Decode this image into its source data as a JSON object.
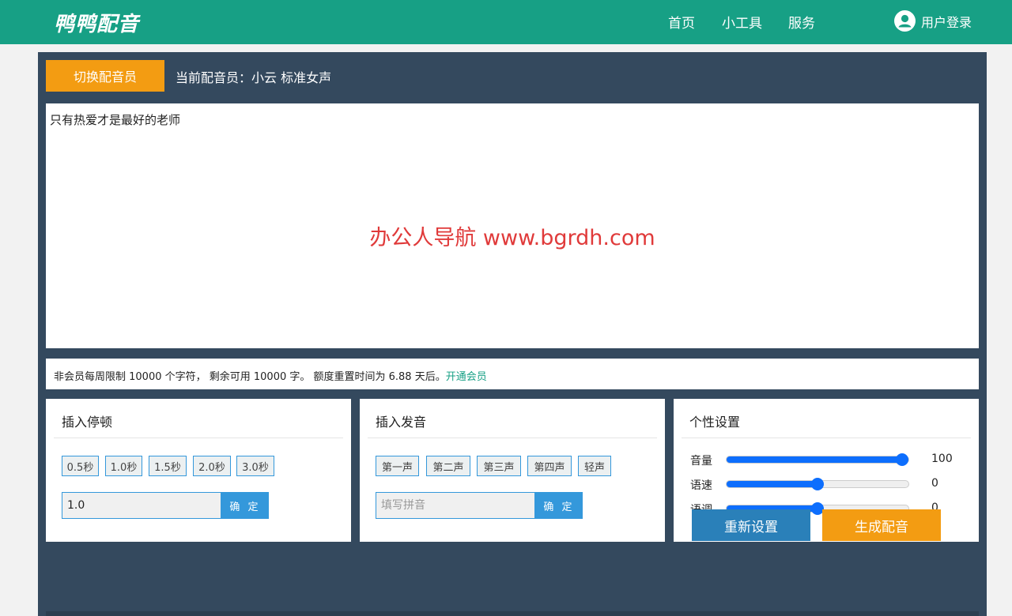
{
  "header": {
    "logo": "鸭鸭配音",
    "nav": [
      "首页",
      "小工具",
      "服务"
    ],
    "login_label": "用户登录"
  },
  "voice": {
    "switch_label": "切换配音员",
    "current_prefix": "当前配音员：",
    "current_name": "小云 标准女声"
  },
  "editor": {
    "text": "只有热爱才是最好的老师",
    "watermark": "办公人导航 www.bgrdh.com"
  },
  "quota": {
    "text": "非会员每周限制 10000 个字符， 剩余可用 10000 字。 额度重置时间为 6.88 天后。",
    "link": "开通会员"
  },
  "pause": {
    "title": "插入停顿",
    "options": [
      "0.5秒",
      "1.0秒",
      "1.5秒",
      "2.0秒",
      "3.0秒"
    ],
    "input_value": "1.0",
    "confirm": "确 定"
  },
  "pronunciation": {
    "title": "插入发音",
    "tones": [
      "第一声",
      "第二声",
      "第三声",
      "第四声",
      "轻声"
    ],
    "placeholder": "填写拼音",
    "confirm": "确 定"
  },
  "settings": {
    "title": "个性设置",
    "sliders": [
      {
        "label": "音量",
        "value": "100",
        "fraction": 1.0
      },
      {
        "label": "语速",
        "value": "0",
        "fraction": 0.5
      },
      {
        "label": "语调",
        "value": "0",
        "fraction": 0.5
      }
    ]
  },
  "actions": {
    "reset": "重新设置",
    "generate": "生成配音"
  },
  "colors": {
    "header": "#17a085",
    "panel": "#34495e",
    "accent_orange": "#f39c12",
    "accent_blue": "#3498db",
    "slider_blue": "#0d6efd",
    "watermark_red": "#e03a3a"
  }
}
